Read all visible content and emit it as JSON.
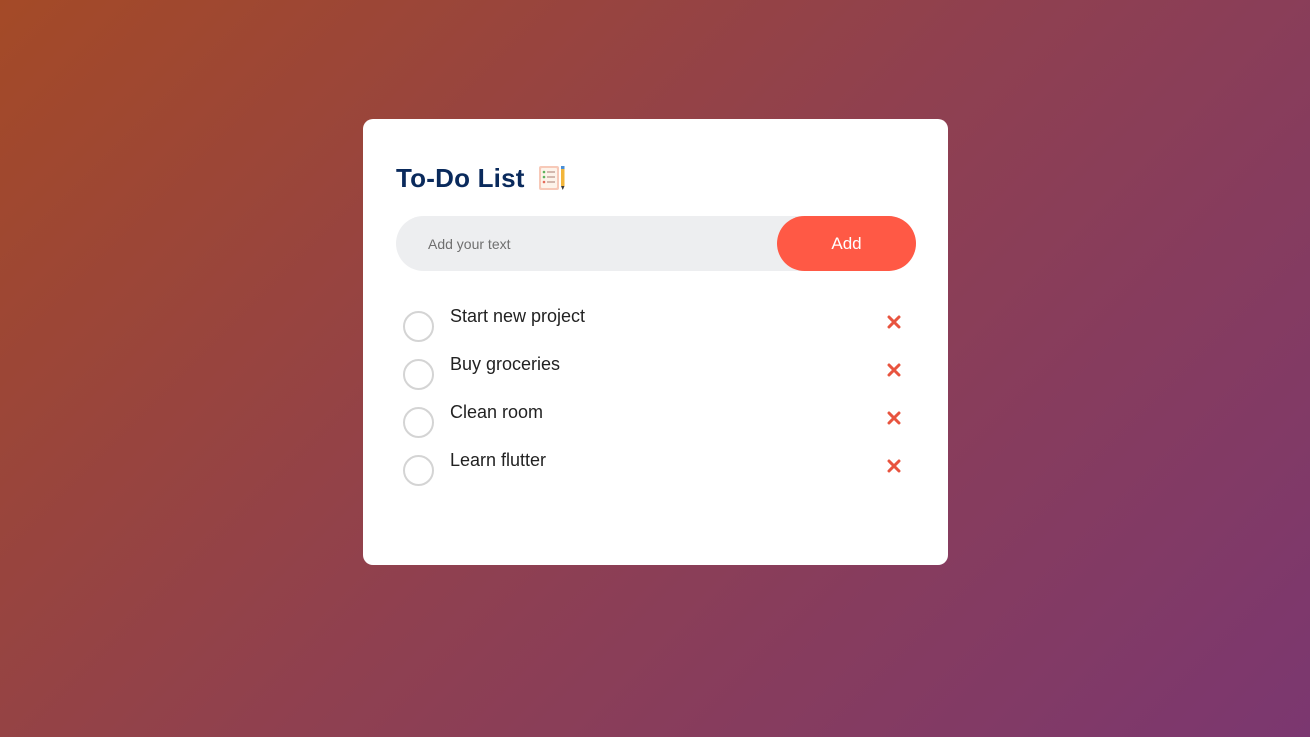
{
  "app": {
    "title": "To-Do List",
    "title_icon": "notepad-checklist-icon"
  },
  "input": {
    "placeholder": "Add your text",
    "value": ""
  },
  "add_button": {
    "label": "Add"
  },
  "colors": {
    "title": "#0a2a5c",
    "accent": "#ff5945",
    "input_bg": "#edeef0",
    "delete_icon": "#e8543f"
  },
  "tasks": [
    {
      "text": "Start new project",
      "checked": false
    },
    {
      "text": "Buy groceries",
      "checked": false
    },
    {
      "text": "Clean room",
      "checked": false
    },
    {
      "text": "Learn flutter",
      "checked": false
    }
  ]
}
